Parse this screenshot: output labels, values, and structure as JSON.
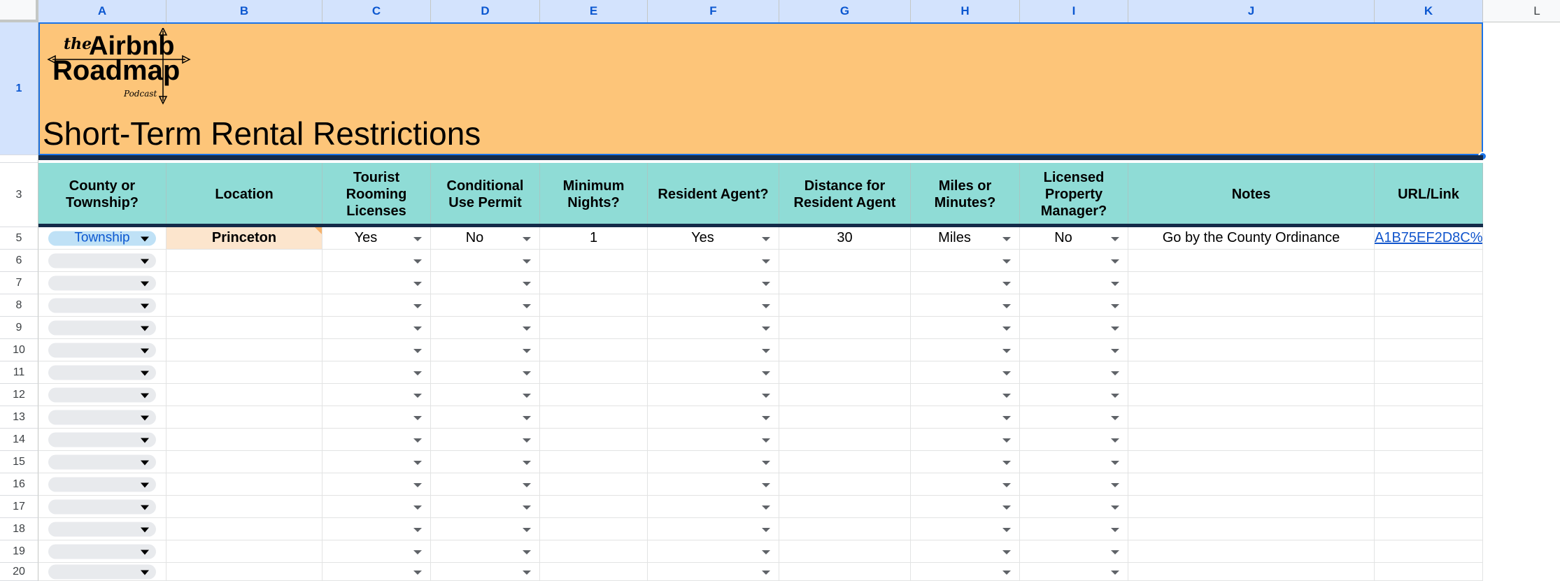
{
  "columns": [
    "A",
    "B",
    "C",
    "D",
    "E",
    "F",
    "G",
    "H",
    "I",
    "J",
    "K",
    "L"
  ],
  "rows": [
    "1",
    "3",
    "5",
    "6",
    "7",
    "8",
    "9",
    "10",
    "11",
    "12",
    "13",
    "14",
    "15",
    "16",
    "17",
    "18",
    "19",
    "20"
  ],
  "logo": {
    "line1": "the",
    "line2": "Airbnb",
    "line3": "Roadmap",
    "line4": "Podcast"
  },
  "title": "Short-Term Rental Restrictions",
  "headers": {
    "a": "County or Township?",
    "b": "Location",
    "c": "Tourist Rooming Licenses",
    "d": "Conditional Use Permit",
    "e": "Minimum Nights?",
    "f": "Resident Agent?",
    "g": "Distance for Resident Agent",
    "h": "Miles or Minutes?",
    "i": "Licensed Property Manager?",
    "j": "Notes",
    "k": "URL/Link"
  },
  "record": {
    "type": "Township",
    "location": "Princeton",
    "tourist_license": "Yes",
    "conditional_permit": "No",
    "min_nights": "1",
    "resident_agent": "Yes",
    "distance": "30",
    "unit": "Miles",
    "licensed_pm": "No",
    "notes": "Go by the County Ordinance",
    "url": "A1B75EF2D8C%"
  },
  "colors": {
    "banner": "#fdc579",
    "header": "#8fdcd6",
    "location": "#fce5cd",
    "chip": "#bfe1f6",
    "border": "#142b49"
  }
}
